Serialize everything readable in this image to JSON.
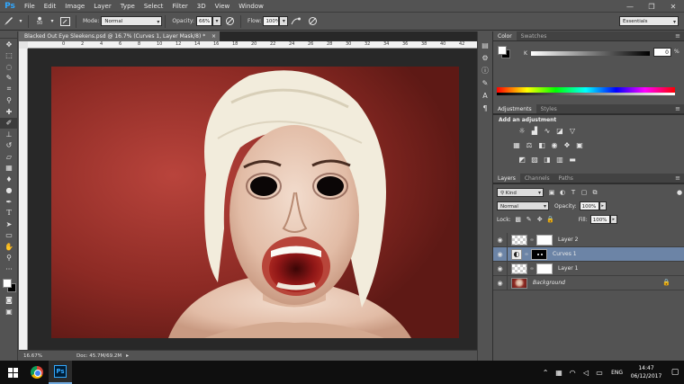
{
  "app": {
    "logo": "Ps",
    "menu": [
      "File",
      "Edit",
      "Image",
      "Layer",
      "Type",
      "Select",
      "Filter",
      "3D",
      "View",
      "Window"
    ],
    "window_controls": [
      "—",
      "❐",
      "✕"
    ]
  },
  "options_bar": {
    "brush_size": "50",
    "mode_label": "Mode:",
    "mode_value": "Normal",
    "opacity_label": "Opacity:",
    "opacity_value": "66%",
    "flow_label": "Flow:",
    "flow_value": "100%",
    "workspace": "Essentials"
  },
  "document": {
    "tab_title": "Blacked Out Eye Sleekens.psd @ 16.7% (Curves 1, Layer Mask/8) *",
    "tab_close": "×",
    "ruler_ticks": [
      "0",
      "2",
      "4",
      "6",
      "8",
      "10",
      "12",
      "14",
      "16",
      "18",
      "20",
      "22",
      "24",
      "26",
      "28",
      "30",
      "32",
      "34",
      "36",
      "38",
      "40",
      "42"
    ],
    "zoom": "16.67%",
    "doc_info": "Doc: 45.7M/69.2M"
  },
  "color_panel": {
    "tabs": [
      "Color",
      "Swatches"
    ],
    "channel": "K",
    "value": "0",
    "unit": "%",
    "colors": {
      "foreground": "#ffffff",
      "background": "#000000"
    }
  },
  "adjustments_panel": {
    "tabs": [
      "Adjustments",
      "Styles"
    ],
    "title": "Add an adjustment"
  },
  "layers_panel": {
    "tabs": [
      "Layers",
      "Channels",
      "Paths"
    ],
    "filter_kind": "Kind",
    "blend_mode": "Normal",
    "opacity_label": "Opacity:",
    "opacity_value": "100%",
    "lock_label": "Lock:",
    "fill_label": "Fill:",
    "fill_value": "100%",
    "layers": [
      {
        "name": "Layer 2",
        "type": "pixel-with-mask",
        "selected": false
      },
      {
        "name": "Curves 1",
        "type": "adjustment",
        "selected": true
      },
      {
        "name": "Layer 1",
        "type": "pixel-with-mask",
        "selected": false
      },
      {
        "name": "Background",
        "type": "background",
        "selected": false
      }
    ]
  },
  "taskbar": {
    "lang": "ENG",
    "time": "14:47",
    "date": "06/12/2017"
  },
  "accent_colors": {
    "selected_layer": "#6c84a6",
    "photoshop_blue": "#31a8ff",
    "canvas_red": "#8e2a24"
  }
}
